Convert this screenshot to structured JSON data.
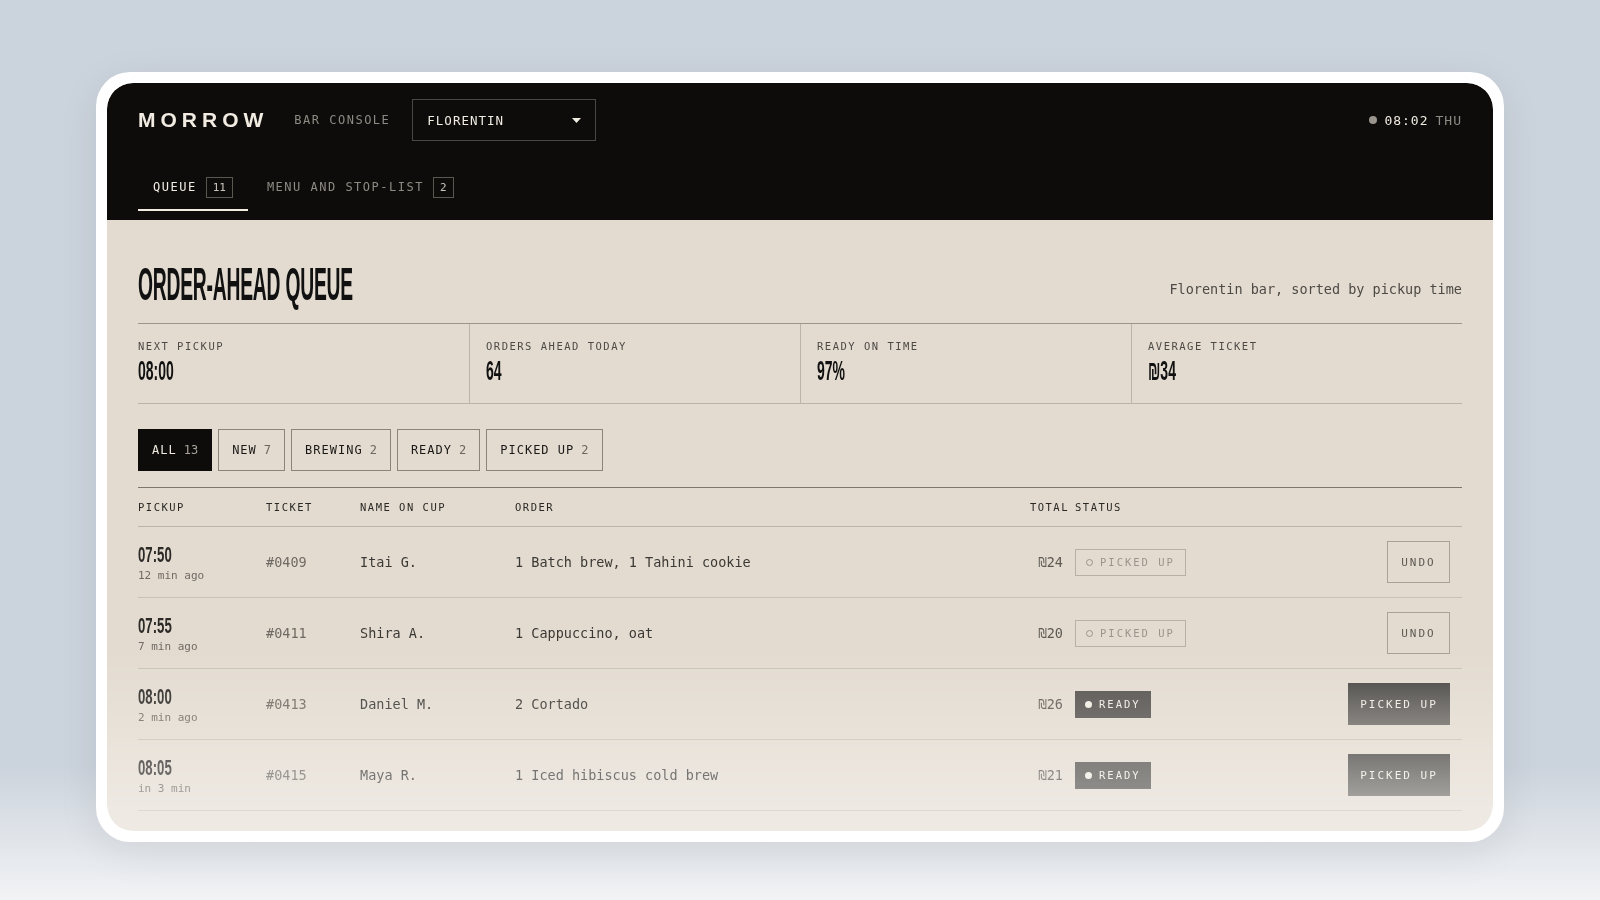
{
  "brand": "MORROW",
  "console_label": "BAR CONSOLE",
  "location_select": {
    "value": "FLORENTIN"
  },
  "clock": {
    "time": "08:02",
    "day": "THU"
  },
  "tabs": [
    {
      "label": "QUEUE",
      "count": "11",
      "selected": true
    },
    {
      "label": "MENU AND STOP-LIST",
      "count": "2",
      "selected": false
    }
  ],
  "page_title": "ORDER-AHEAD QUEUE",
  "subtitle": "Florentin bar, sorted by pickup time",
  "stats": [
    {
      "label": "NEXT PICKUP",
      "value": "08:00"
    },
    {
      "label": "ORDERS AHEAD TODAY",
      "value": "64"
    },
    {
      "label": "READY ON TIME",
      "value": "97%"
    },
    {
      "label": "AVERAGE TICKET",
      "value": "₪34"
    }
  ],
  "filters": [
    {
      "label": "ALL",
      "count": "13",
      "selected": true
    },
    {
      "label": "NEW",
      "count": "7",
      "selected": false
    },
    {
      "label": "BREWING",
      "count": "2",
      "selected": false
    },
    {
      "label": "READY",
      "count": "2",
      "selected": false
    },
    {
      "label": "PICKED UP",
      "count": "2",
      "selected": false
    }
  ],
  "table": {
    "columns": [
      "PICKUP",
      "TICKET",
      "NAME ON CUP",
      "ORDER",
      "TOTAL",
      "STATUS"
    ],
    "rows": [
      {
        "pickup": "07:50",
        "when": "12 min ago",
        "ticket": "#0409",
        "name": "Itai G.",
        "order": "1 Batch brew, 1 Tahini cookie",
        "total": "₪24",
        "status": {
          "kind": "picked_up",
          "label": "PICKED UP"
        },
        "action": {
          "kind": "undo",
          "label": "UNDO"
        }
      },
      {
        "pickup": "07:55",
        "when": "7 min ago",
        "ticket": "#0411",
        "name": "Shira A.",
        "order": "1 Cappuccino, oat",
        "total": "₪20",
        "status": {
          "kind": "picked_up",
          "label": "PICKED UP"
        },
        "action": {
          "kind": "undo",
          "label": "UNDO"
        }
      },
      {
        "pickup": "08:00",
        "when": "2 min ago",
        "ticket": "#0413",
        "name": "Daniel M.",
        "order": "2 Cortado",
        "total": "₪26",
        "status": {
          "kind": "ready",
          "label": "READY"
        },
        "action": {
          "kind": "advance",
          "label": "PICKED UP"
        }
      },
      {
        "pickup": "08:05",
        "when": "in 3 min",
        "ticket": "#0415",
        "name": "Maya R.",
        "order": "1 Iced hibiscus cold brew",
        "total": "₪21",
        "status": {
          "kind": "ready",
          "label": "READY"
        },
        "action": {
          "kind": "advance",
          "label": "PICKED UP"
        }
      }
    ]
  }
}
